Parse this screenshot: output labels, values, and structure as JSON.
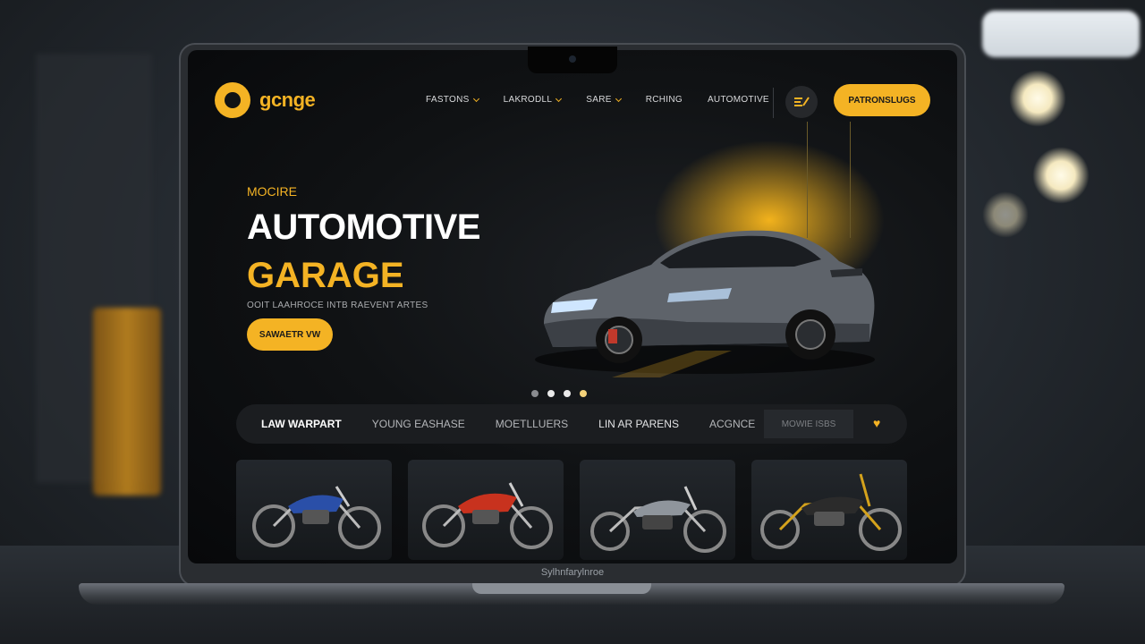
{
  "site": {
    "logo_text": "gcnge"
  },
  "nav": {
    "items": [
      {
        "label": "FASTONS",
        "has_dropdown": true
      },
      {
        "label": "LAKRODLL",
        "has_dropdown": true
      },
      {
        "label": "SARE",
        "has_dropdown": true
      },
      {
        "label": "RCHING",
        "has_dropdown": false
      },
      {
        "label": "AUTOMOTIVE",
        "has_dropdown": false
      }
    ],
    "menu_icon": "menu-pen-icon",
    "cta_label": "PATRONSLUGS"
  },
  "hero": {
    "eyebrow": "MOCIRE",
    "title_line1": "AUTOMOTIVE",
    "title_line2": "GARAGE",
    "subtitle": "OOIT LAAHROCE INTB RAEVENT ARTES",
    "button_label": "SAWAETR VW",
    "slides": {
      "total": 4,
      "active": 1
    }
  },
  "categories": {
    "items": [
      "LAW WARPART",
      "YOUNG EASHASE",
      "MOETLLUERS",
      "LIN AR PARENS",
      "ACGNCE"
    ],
    "active_index": 0,
    "search_placeholder": "MOWIE ISBS",
    "favorite_icon": "heart-icon"
  },
  "products": [
    {
      "name": "motorcycle-blue",
      "color": "#2a4fa8"
    },
    {
      "name": "motorcycle-red",
      "color": "#c8321e"
    },
    {
      "name": "motorcycle-silver",
      "color": "#8f959c"
    },
    {
      "name": "motorcycle-gold",
      "color": "#d4a21c"
    }
  ],
  "laptop": {
    "chin_label": "Sylhnfarylnroe"
  },
  "colors": {
    "accent": "#f4b324",
    "background": "#101214"
  }
}
